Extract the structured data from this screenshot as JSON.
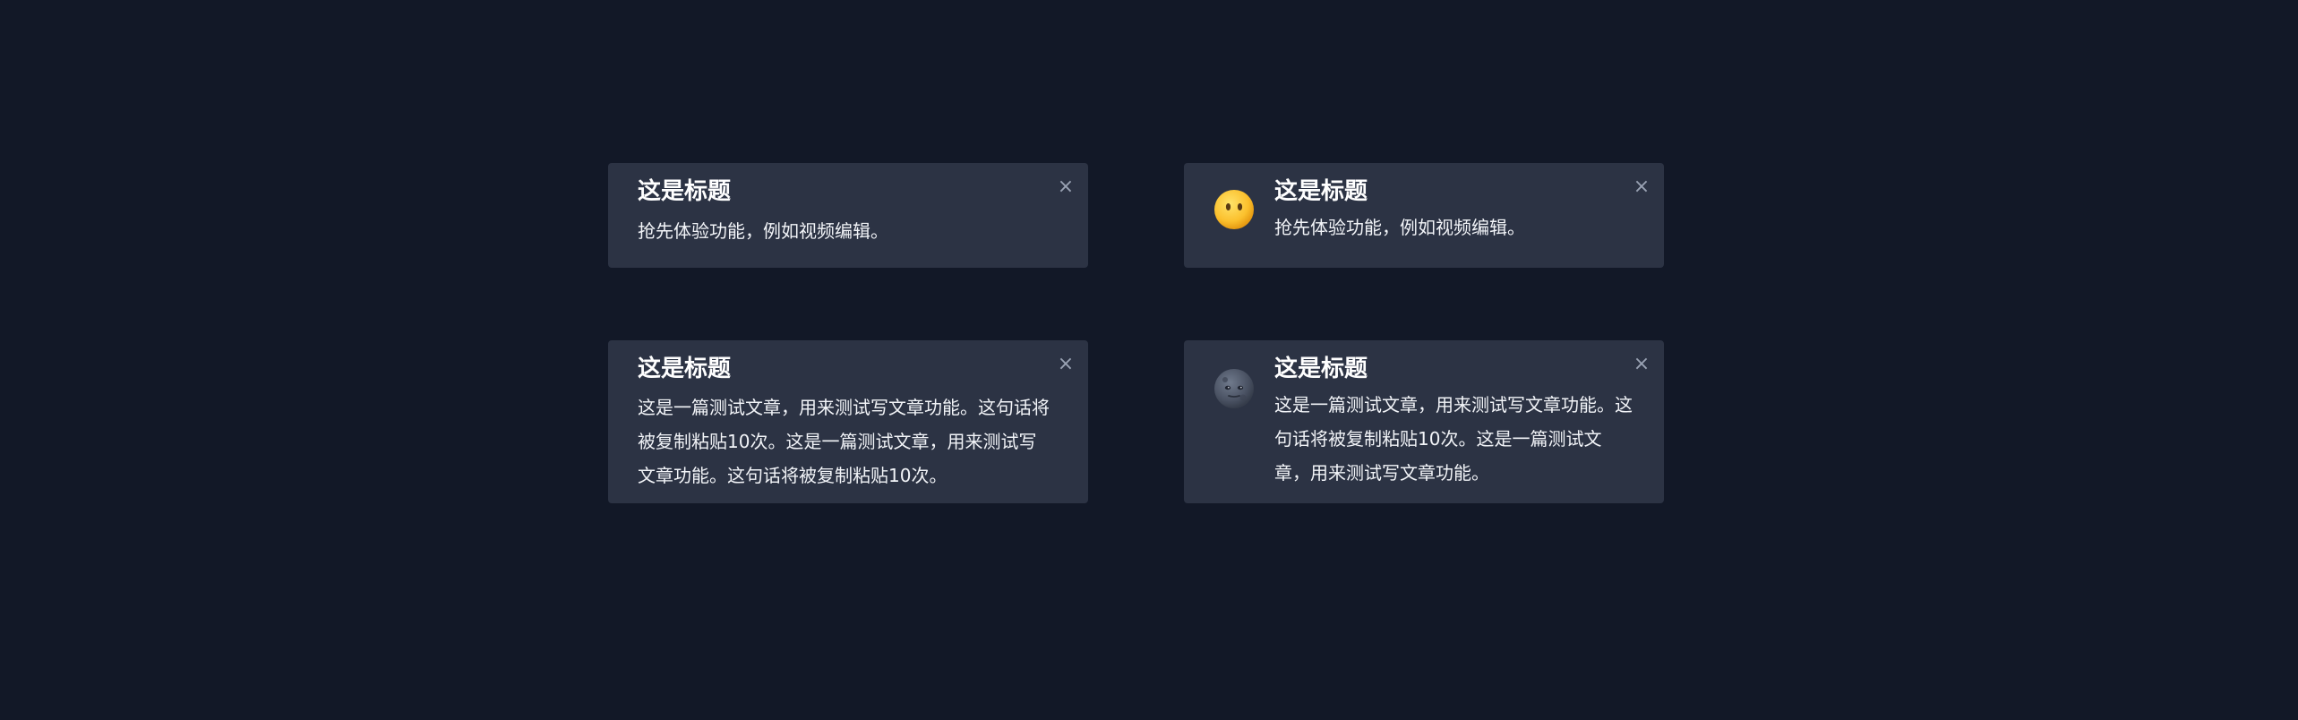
{
  "theme": {
    "background": "#121827",
    "card": "#2c3344",
    "text": "#ffffff",
    "close": "#9aa3b4"
  },
  "toasts": [
    {
      "title": "这是标题",
      "body": "抢先体验功能，例如视频编辑。",
      "close": "×",
      "icon": null
    },
    {
      "title": "这是标题",
      "body": "抢先体验功能，例如视频编辑。",
      "close": "×",
      "icon": "neutral-face-no-mouth-emoji-icon"
    },
    {
      "title": "这是标题",
      "body": "这是一篇测试文章，用来测试写文章功能。这句话将被复制粘贴10次。这是一篇测试文章，用来测试写文章功能。这句话将被复制粘贴10次。",
      "close": "×",
      "icon": null
    },
    {
      "title": "这是标题",
      "body": "这是一篇测试文章，用来测试写文章功能。这句话将被复制粘贴10次。这是一篇测试文章，用来测试写文章功能。",
      "close": "×",
      "icon": "new-moon-face-emoji-icon"
    }
  ]
}
